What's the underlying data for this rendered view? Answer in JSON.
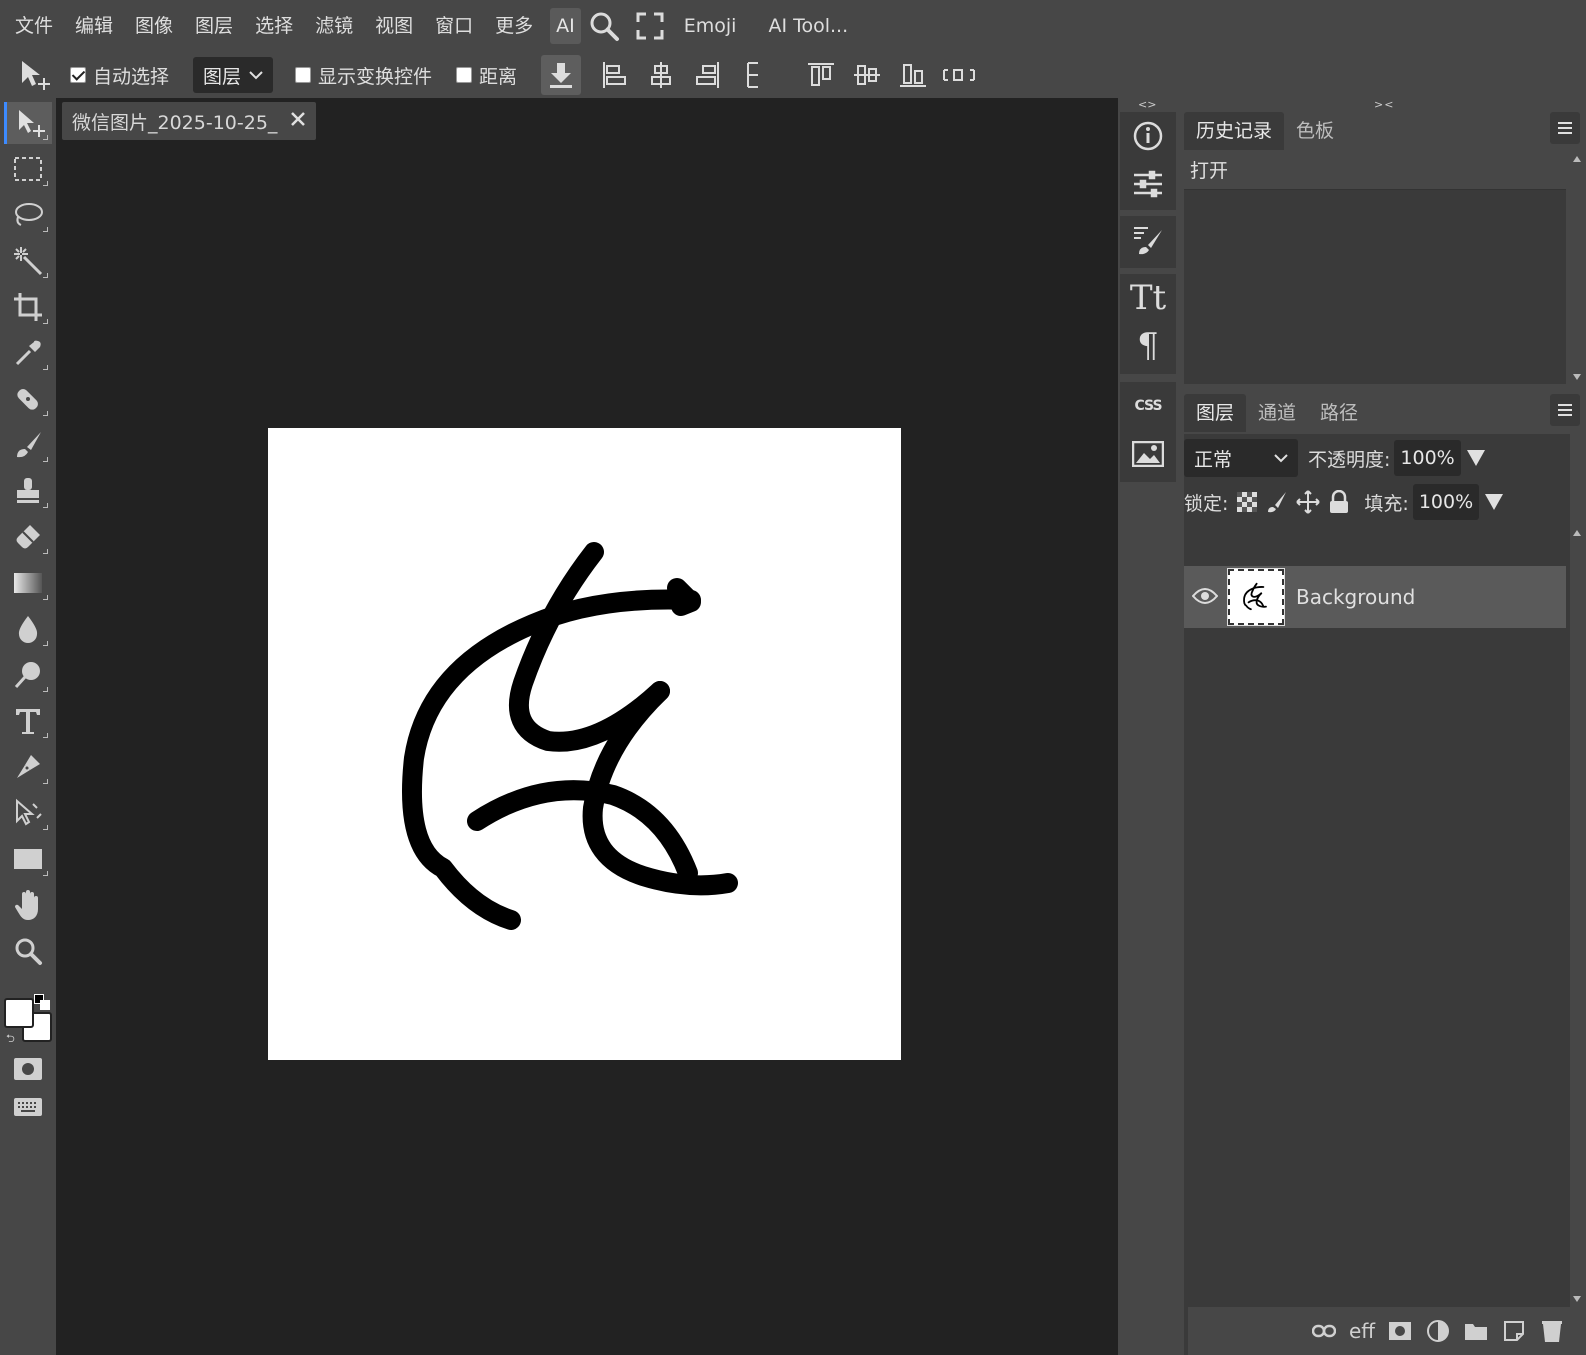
{
  "menu": {
    "items": [
      "文件",
      "编辑",
      "图像",
      "图层",
      "选择",
      "滤镜",
      "视图",
      "窗口",
      "更多"
    ],
    "ai_label": "AI",
    "emoji_label": "Emoji",
    "ai_tools_label": "AI Tool..."
  },
  "options": {
    "auto_select_label": "自动选择",
    "auto_select_checked": true,
    "target_select_value": "图层",
    "show_transform_label": "显示变换控件",
    "show_transform_checked": false,
    "distance_label": "距离",
    "distance_checked": false
  },
  "document": {
    "tab_title": "微信图片_2025-10-25_",
    "canvas_color": "#ffffff",
    "stroke_color": "#000000"
  },
  "history_panel": {
    "tabs": [
      "历史记录",
      "色板"
    ],
    "active_tab": "历史记录",
    "items": [
      "打开"
    ]
  },
  "layers_panel": {
    "tabs": [
      "图层",
      "通道",
      "路径"
    ],
    "active_tab": "图层",
    "blend_mode": "正常",
    "opacity_label": "不透明度:",
    "opacity_value": "100%",
    "lock_label": "锁定:",
    "fill_label": "填充:",
    "fill_value": "100%",
    "layers": [
      {
        "name": "Background",
        "visible": true
      }
    ],
    "footer_icons": [
      "link-icon",
      "effects-icon",
      "mask-icon",
      "adjustment-icon",
      "folder-icon",
      "new-layer-icon",
      "trash-icon"
    ],
    "effects_label": "eff"
  },
  "colors": {
    "background": "#474747",
    "panel_dark": "#3a3a3a",
    "workspace": "#222222",
    "accent": "#3d8bff",
    "foreground_swatch": "#ffffff",
    "background_swatch": "#ffffff"
  }
}
